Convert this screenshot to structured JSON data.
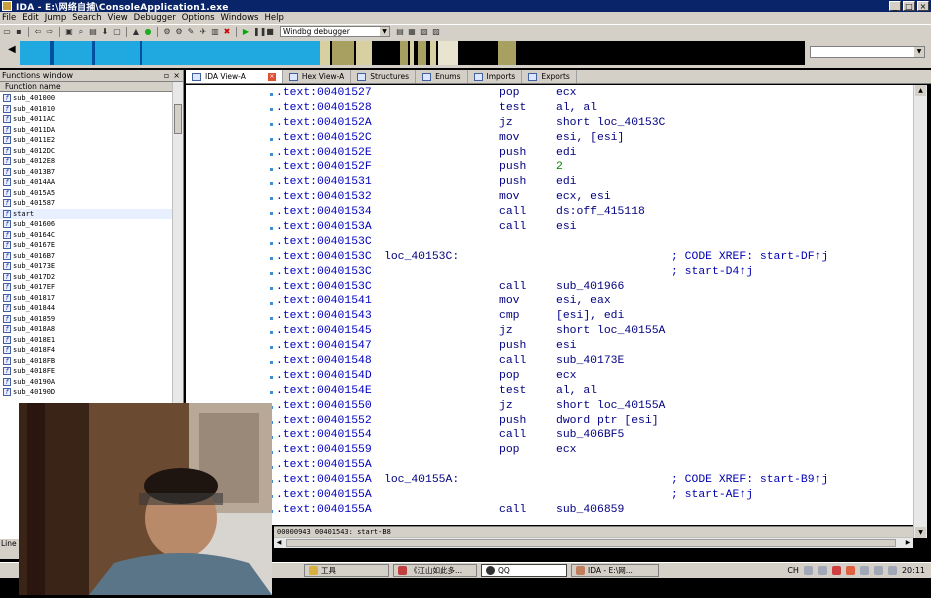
{
  "window": {
    "title": "IDA - E:\\网络自捕\\ConsoleApplication1.exe",
    "buttons": [
      "_",
      "□",
      "×"
    ]
  },
  "menu": [
    "File",
    "Edit",
    "Jump",
    "Search",
    "View",
    "Debugger",
    "Options",
    "Windows",
    "Help"
  ],
  "toolbar": {
    "debugger_select": "Windbg debugger"
  },
  "functions_window": {
    "title": "Functions window",
    "column": "Function name",
    "items": [
      "sub_401000",
      "sub_401010",
      "sub_4011AC",
      "sub_4011DA",
      "sub_4011E2",
      "sub_4012DC",
      "sub_4012E8",
      "sub_4013B7",
      "sub_4014AA",
      "sub_4015A5",
      "sub_401587",
      "start",
      "sub_401606",
      "sub_40164C",
      "sub_40167E",
      "sub_4016B7",
      "sub_40173E",
      "sub_4017D2",
      "sub_4017EF",
      "sub_401817",
      "sub_401844",
      "sub_401859",
      "sub_4018A8",
      "sub_4018E1",
      "sub_4018F4",
      "sub_4018FB",
      "sub_4018FE",
      "sub_40190A",
      "sub_40190D"
    ],
    "selected": "start"
  },
  "tabs": [
    {
      "label": "IDA View-A",
      "active": true
    },
    {
      "label": "Hex View-A",
      "active": false
    },
    {
      "label": "Structures",
      "active": false
    },
    {
      "label": "Enums",
      "active": false
    },
    {
      "label": "Imports",
      "active": false
    },
    {
      "label": "Exports",
      "active": false
    }
  ],
  "disassembly": [
    {
      "addr": ".text:00401527",
      "label": "",
      "mn": "pop",
      "op": "ecx",
      "cmt": ""
    },
    {
      "addr": ".text:00401528",
      "label": "",
      "mn": "test",
      "op": "al, al",
      "cmt": ""
    },
    {
      "addr": ".text:0040152A",
      "label": "",
      "mn": "jz",
      "op": "short loc_40153C",
      "cmt": ""
    },
    {
      "addr": ".text:0040152C",
      "label": "",
      "mn": "mov",
      "op": "esi, [esi]",
      "cmt": ""
    },
    {
      "addr": ".text:0040152E",
      "label": "",
      "mn": "push",
      "op": "edi",
      "cmt": ""
    },
    {
      "addr": ".text:0040152F",
      "label": "",
      "mn": "push",
      "op": "2",
      "num": true,
      "cmt": ""
    },
    {
      "addr": ".text:00401531",
      "label": "",
      "mn": "push",
      "op": "edi",
      "cmt": ""
    },
    {
      "addr": ".text:00401532",
      "label": "",
      "mn": "mov",
      "op": "ecx, esi",
      "cmt": ""
    },
    {
      "addr": ".text:00401534",
      "label": "",
      "mn": "call",
      "op": "ds:off_415118",
      "cmt": ""
    },
    {
      "addr": ".text:0040153A",
      "label": "",
      "mn": "call",
      "op": "esi",
      "cmt": ""
    },
    {
      "addr": ".text:0040153C",
      "label": "",
      "mn": "",
      "op": "",
      "cmt": ""
    },
    {
      "addr": ".text:0040153C",
      "label": "loc_40153C:",
      "mn": "",
      "op": "",
      "cmt": "; CODE XREF: start-DF↑j"
    },
    {
      "addr": ".text:0040153C",
      "label": "",
      "mn": "",
      "op": "",
      "cmt": "; start-D4↑j"
    },
    {
      "addr": ".text:0040153C",
      "label": "",
      "mn": "call",
      "op": "sub_401966",
      "cmt": ""
    },
    {
      "addr": ".text:00401541",
      "label": "",
      "mn": "mov",
      "op": "esi, eax",
      "cmt": ""
    },
    {
      "addr": ".text:00401543",
      "label": "",
      "mn": "cmp",
      "op": "[esi], edi",
      "cmt": ""
    },
    {
      "addr": ".text:00401545",
      "label": "",
      "mn": "jz",
      "op": "short loc_40155A",
      "cmt": ""
    },
    {
      "addr": ".text:00401547",
      "label": "",
      "mn": "push",
      "op": "esi",
      "cmt": ""
    },
    {
      "addr": ".text:00401548",
      "label": "",
      "mn": "call",
      "op": "sub_40173E",
      "cmt": ""
    },
    {
      "addr": ".text:0040154D",
      "label": "",
      "mn": "pop",
      "op": "ecx",
      "cmt": ""
    },
    {
      "addr": ".text:0040154E",
      "label": "",
      "mn": "test",
      "op": "al, al",
      "cmt": ""
    },
    {
      "addr": ".text:00401550",
      "label": "",
      "mn": "jz",
      "op": "short loc_40155A",
      "cmt": ""
    },
    {
      "addr": ".text:00401552",
      "label": "",
      "mn": "push",
      "op": "dword ptr [esi]",
      "cmt": ""
    },
    {
      "addr": ".text:00401554",
      "label": "",
      "mn": "call",
      "op": "sub_406BF5",
      "cmt": ""
    },
    {
      "addr": ".text:00401559",
      "label": "",
      "mn": "pop",
      "op": "ecx",
      "cmt": ""
    },
    {
      "addr": ".text:0040155A",
      "label": "",
      "mn": "",
      "op": "",
      "cmt": ""
    },
    {
      "addr": ".text:0040155A",
      "label": "loc_40155A:",
      "mn": "",
      "op": "",
      "cmt": "; CODE XREF: start-B9↑j"
    },
    {
      "addr": ".text:0040155A",
      "label": "",
      "mn": "",
      "op": "",
      "cmt": "; start-AE↑j"
    },
    {
      "addr": ".text:0040155A",
      "label": "",
      "mn": "call",
      "op": "sub_406859",
      "cmt": ""
    }
  ],
  "status_line": "00000943 00401543: start-B8",
  "output_label": "Line",
  "taskbar": [
    {
      "label": "工具",
      "active": false
    },
    {
      "label": "《江山如此多...",
      "active": false
    },
    {
      "label": "QQ",
      "active": true
    },
    {
      "label": "IDA - E:\\网...",
      "active": false
    }
  ],
  "tray": {
    "ime": "CH",
    "time": "20:11"
  },
  "colors": {
    "address": "#0000c0",
    "immediate": "#008000",
    "titlebar": "#0a246a"
  }
}
